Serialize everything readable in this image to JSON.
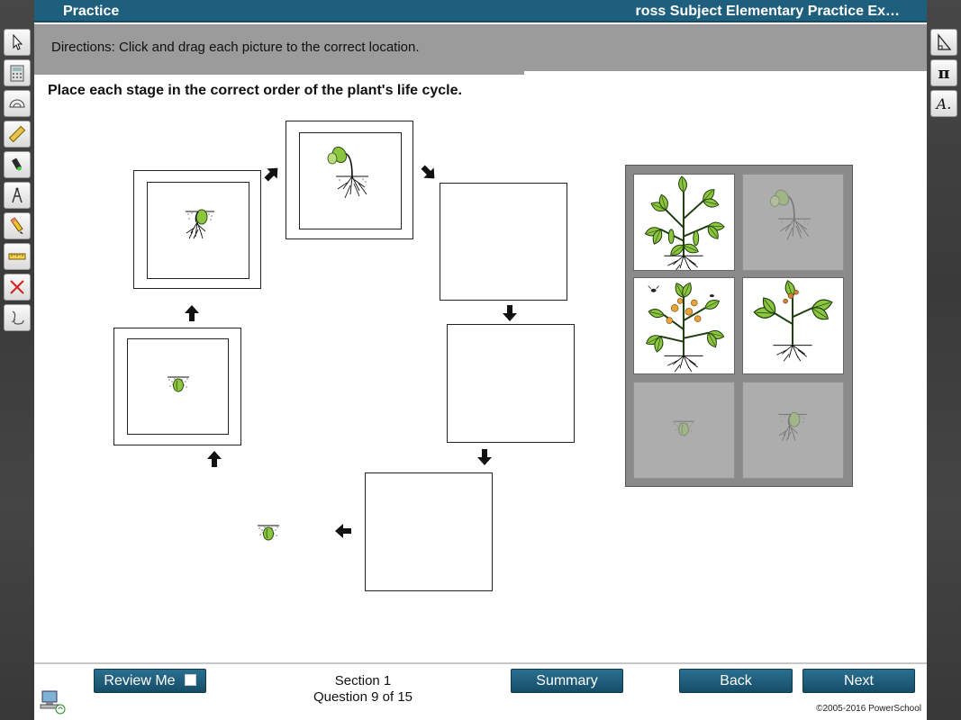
{
  "header": {
    "title_left": "Practice",
    "title_right": "ross Subject Elementary Practice Ex…"
  },
  "directions": "Directions: Click and drag each picture to the correct location.",
  "question": {
    "prompt": "Place each stage in the correct order of the plant's life cycle."
  },
  "left_tools": [
    "pointer-icon",
    "calculator-icon",
    "protractor-icon",
    "ruler-icon",
    "highlighter-icon",
    "compass-icon",
    "pencil-icon",
    "line-ruler-icon",
    "eliminator-icon",
    "eraser-icon"
  ],
  "right_tools": [
    "triangle-icon",
    "pi-icon",
    "text-icon"
  ],
  "right_tool_labels": {
    "pi": "π",
    "text": "A."
  },
  "cycle": {
    "filled_slots": [
      "seed",
      "sprouting-seed",
      "seedling"
    ],
    "empty_slots": 3,
    "start_image": "seed"
  },
  "tray": {
    "tiles": [
      {
        "image": "mature-plant",
        "state": "available"
      },
      {
        "image": "seedling",
        "state": "used"
      },
      {
        "image": "flowering-plant",
        "state": "available"
      },
      {
        "image": "young-plant",
        "state": "available"
      },
      {
        "image": "seed",
        "state": "used"
      },
      {
        "image": "sprouting-seed",
        "state": "used"
      }
    ]
  },
  "footer": {
    "review_label": "Review Me",
    "section_label": "Section 1",
    "question_label": "Question 9 of 15",
    "summary_label": "Summary",
    "back_label": "Back",
    "next_label": "Next",
    "copyright": "©2005-2016 PowerSchool"
  },
  "colors": {
    "header_blue": "#1f5f7e",
    "button_blue": "#1f5f7e",
    "directions_gray": "#9b9b9b",
    "tray_gray": "#8a8a8a",
    "leaf_green": "#8cc63f"
  }
}
